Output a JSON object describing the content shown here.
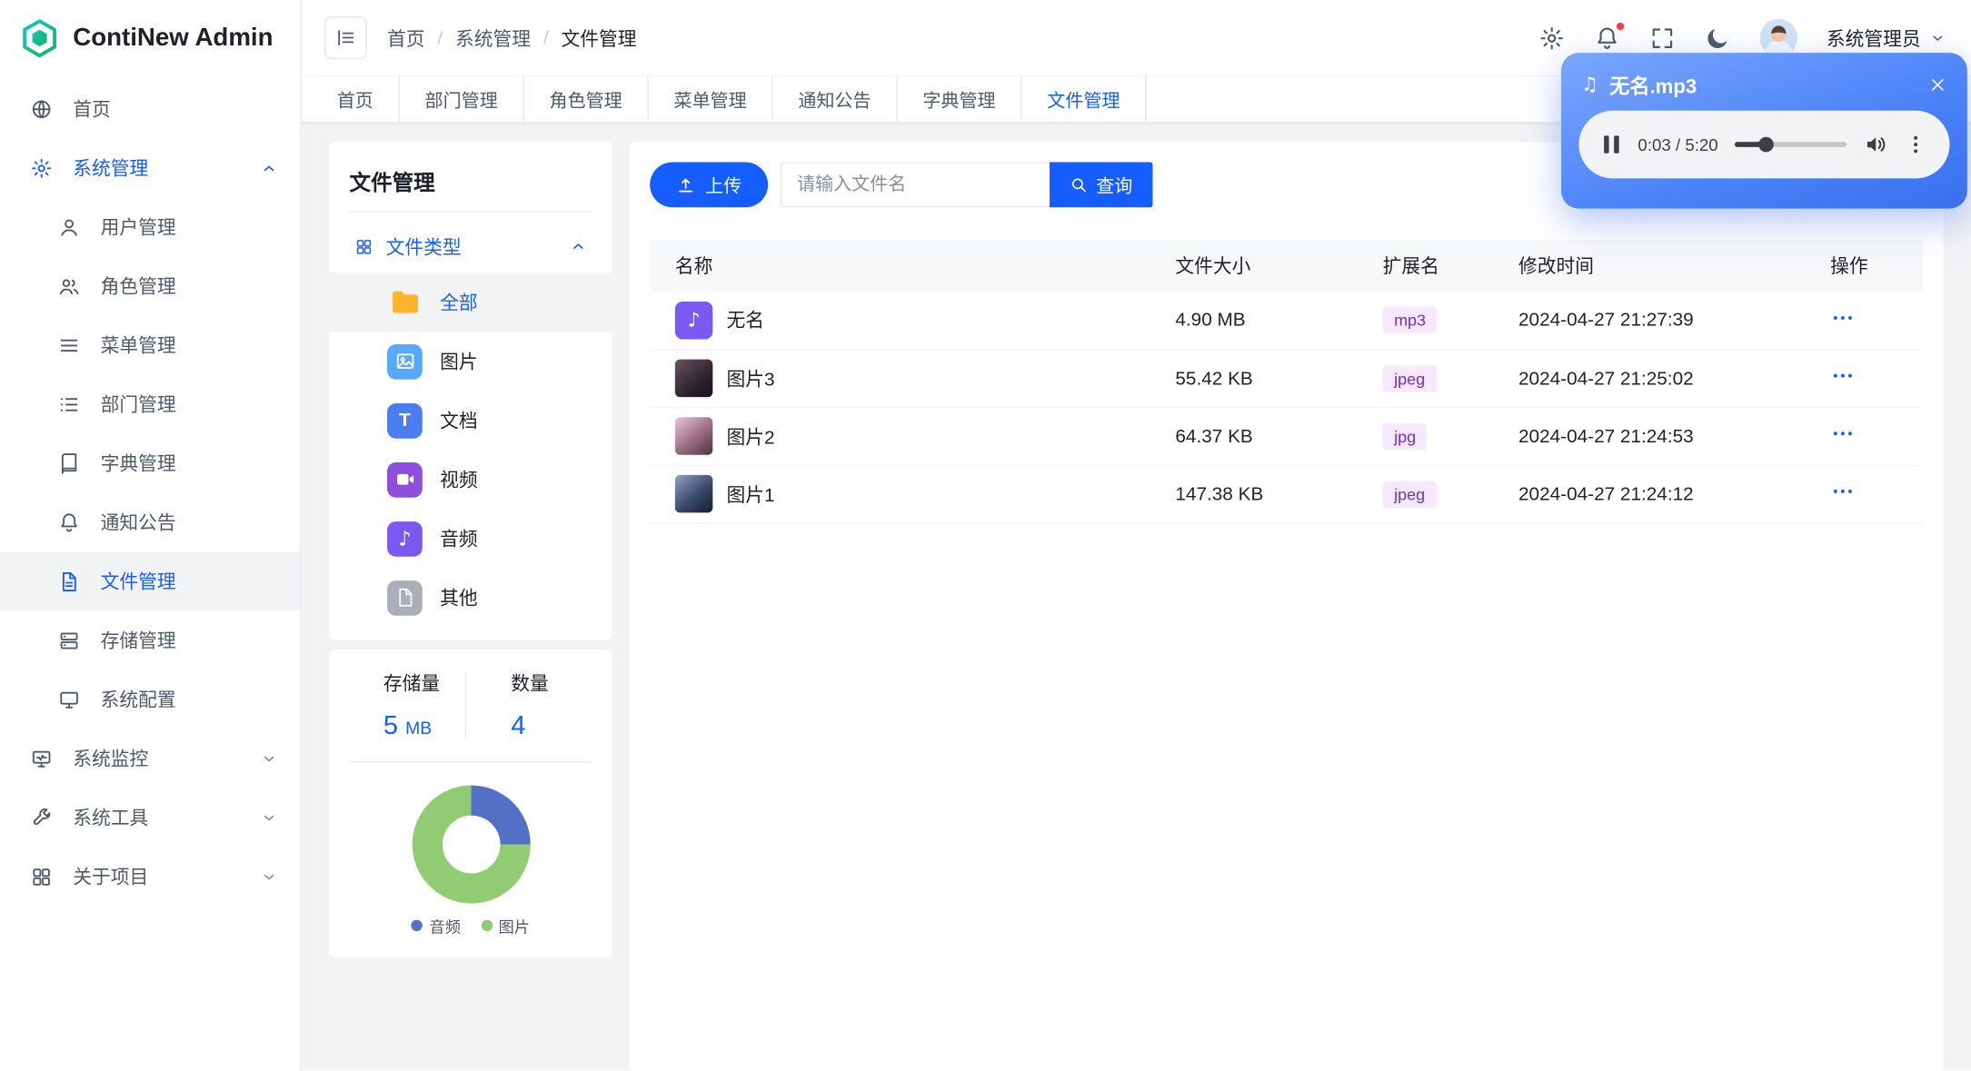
{
  "app": {
    "name": "ContiNew Admin"
  },
  "colors": {
    "primary": "#165dff",
    "tag_bg": "#f5e8ff",
    "tag_text": "#722ed1",
    "notification_dot": "#f53f3f"
  },
  "header": {
    "breadcrumb": [
      "首页",
      "系统管理",
      "文件管理"
    ],
    "actions": [
      {
        "icon": "gear"
      },
      {
        "icon": "bell",
        "badge": true
      },
      {
        "icon": "fullscreen"
      },
      {
        "icon": "moon"
      }
    ],
    "user_name": "系统管理员"
  },
  "tabs": {
    "items": [
      "首页",
      "部门管理",
      "角色管理",
      "菜单管理",
      "通知公告",
      "字典管理",
      "文件管理"
    ],
    "active": "文件管理"
  },
  "sidebar": {
    "items": [
      {
        "label": "首页",
        "icon": "globe"
      },
      {
        "label": "系统管理",
        "icon": "gear",
        "expanded": true,
        "children": [
          {
            "label": "用户管理",
            "icon": "user"
          },
          {
            "label": "角色管理",
            "icon": "users"
          },
          {
            "label": "菜单管理",
            "icon": "menu"
          },
          {
            "label": "部门管理",
            "icon": "tree"
          },
          {
            "label": "字典管理",
            "icon": "book"
          },
          {
            "label": "通知公告",
            "icon": "bell"
          },
          {
            "label": "文件管理",
            "icon": "file"
          },
          {
            "label": "存储管理",
            "icon": "storage"
          },
          {
            "label": "系统配置",
            "icon": "desktop"
          }
        ]
      },
      {
        "label": "系统监控",
        "icon": "monitor",
        "collapsible": true
      },
      {
        "label": "系统工具",
        "icon": "tool",
        "collapsible": true
      },
      {
        "label": "关于项目",
        "icon": "grid",
        "collapsible": true
      }
    ],
    "active_child": "文件管理"
  },
  "filter_panel": {
    "title": "文件管理",
    "section": "文件类型",
    "types": [
      {
        "label": "全部",
        "icon": "folder",
        "color": "#ffb42a",
        "active": true
      },
      {
        "label": "图片",
        "icon": "image",
        "color": "#57a9fb"
      },
      {
        "label": "文档",
        "icon": "doc",
        "color": "#4a7df0"
      },
      {
        "label": "视频",
        "icon": "video",
        "color": "#8f4fdc"
      },
      {
        "label": "音频",
        "icon": "music",
        "color": "#7b58f0"
      },
      {
        "label": "其他",
        "icon": "fileplain",
        "color": "#a9aeb8"
      }
    ]
  },
  "stats": {
    "storage_label": "存储量",
    "storage_value": "5",
    "storage_unit": "MB",
    "count_label": "数量",
    "count_value": "4"
  },
  "chart_data": {
    "type": "pie",
    "donut": true,
    "labels": [
      "音频",
      "图片"
    ],
    "values": [
      1,
      3
    ],
    "colors": [
      "#5470c6",
      "#91cc75"
    ],
    "legend_position": "bottom"
  },
  "toolbar": {
    "upload": "上传",
    "search_placeholder": "请输入文件名",
    "query": "查询"
  },
  "table": {
    "columns": [
      "名称",
      "文件大小",
      "扩展名",
      "修改时间",
      "操作"
    ],
    "rows": [
      {
        "name": "无名",
        "type": "audio",
        "size": "4.90 MB",
        "ext": "mp3",
        "time": "2024-04-27 21:27:39"
      },
      {
        "name": "图片3",
        "type": "image",
        "size": "55.42 KB",
        "ext": "jpeg",
        "time": "2024-04-27 21:25:02"
      },
      {
        "name": "图片2",
        "type": "image",
        "size": "64.37 KB",
        "ext": "jpg",
        "time": "2024-04-27 21:24:53"
      },
      {
        "name": "图片1",
        "type": "image",
        "size": "147.38 KB",
        "ext": "jpeg",
        "time": "2024-04-27 21:24:12"
      }
    ]
  },
  "player": {
    "title": "无名.mp3",
    "time": "0:03 / 5:20",
    "progress_percent": 28
  }
}
